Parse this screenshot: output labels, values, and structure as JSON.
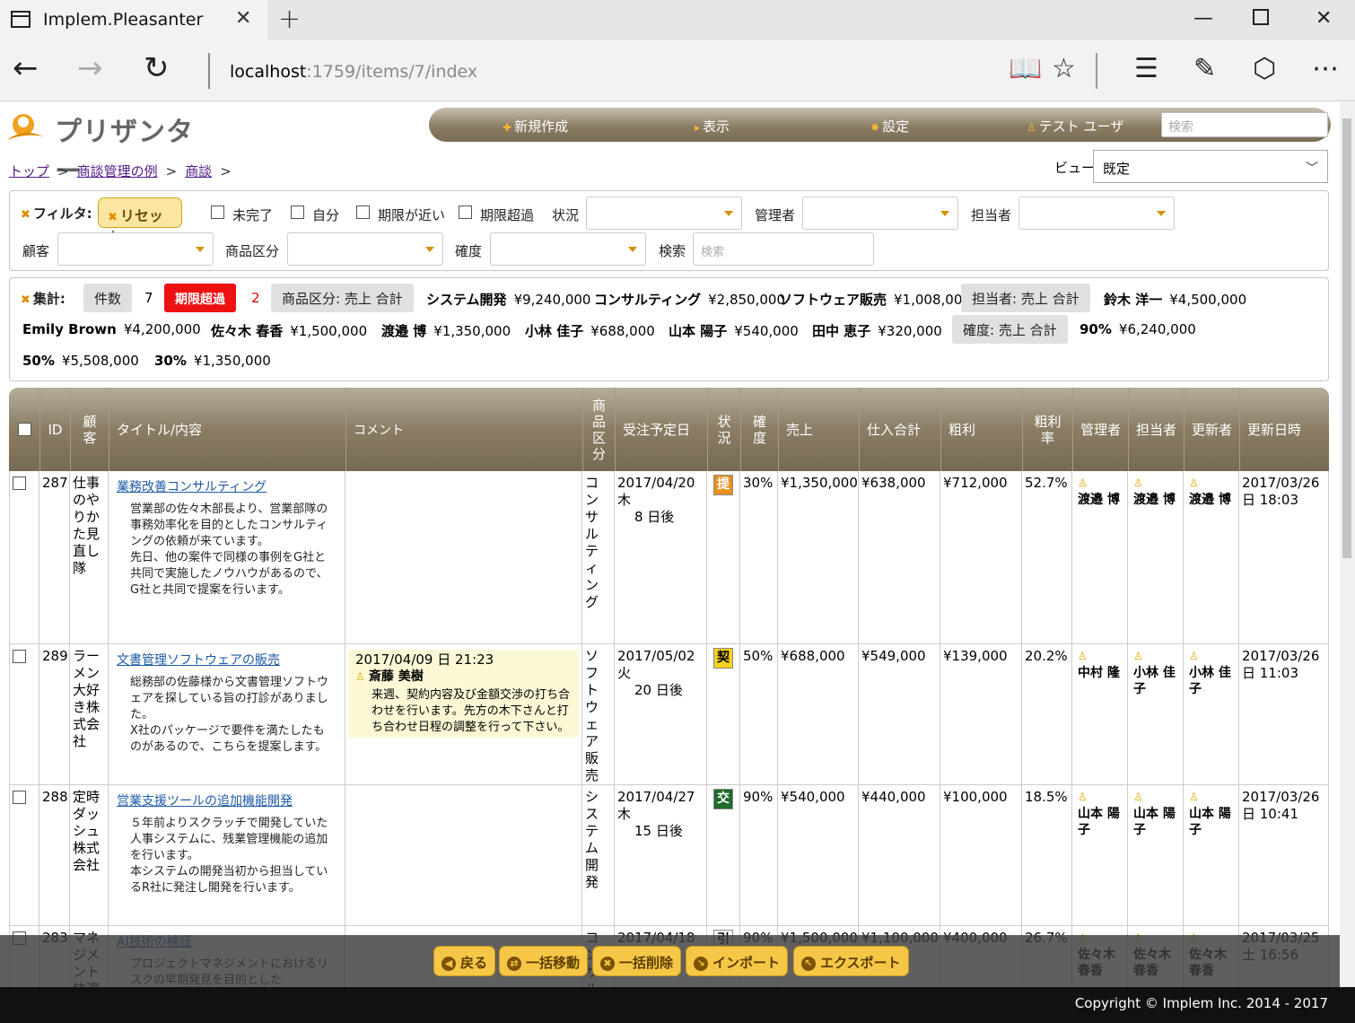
{
  "browser": {
    "tab_title": "Implem.Pleasanter",
    "url_host": "localhost",
    "url_path": ":1759/items/7/index"
  },
  "app": {
    "logo_text": "プリザンター",
    "nav": {
      "new": "新規作成",
      "view": "表示",
      "settings": "設定",
      "user": "テスト ユーザ",
      "search_placeholder": "検索"
    }
  },
  "breadcrumb": [
    "トップ",
    "商談管理の例",
    "商談"
  ],
  "view": {
    "label": "ビュー",
    "selected": "既定"
  },
  "filter": {
    "label": "フィルタ:",
    "reset": "リセット",
    "checks": [
      "未完了",
      "自分",
      "期限が近い",
      "期限超過"
    ],
    "status": "状況",
    "manager": "管理者",
    "owner": "担当者",
    "customer": "顧客",
    "product_type": "商品区分",
    "probability": "確度",
    "search": "検索",
    "search_placeholder": "検索"
  },
  "summary": {
    "label": "集計:",
    "count_label": "件数",
    "count_value": "7",
    "overdue_label": "期限超過",
    "overdue_value": "2",
    "group1": "商品区分: 売上 合計",
    "g1_items": [
      {
        "name": "システム開発",
        "value": "¥9,240,000"
      },
      {
        "name": "コンサルティング",
        "value": "¥2,850,000"
      },
      {
        "name": "ソフトウェア販売",
        "value": "¥1,008,000"
      }
    ],
    "group2": "担当者: 売上 合計",
    "g2_items": [
      {
        "name": "鈴木 洋一",
        "value": "¥4,500,000"
      },
      {
        "name": "Emily Brown",
        "value": "¥4,200,000"
      },
      {
        "name": "佐々木 春香",
        "value": "¥1,500,000"
      },
      {
        "name": "渡邉 博",
        "value": "¥1,350,000"
      },
      {
        "name": "小林 佳子",
        "value": "¥688,000"
      },
      {
        "name": "山本 陽子",
        "value": "¥540,000"
      },
      {
        "name": "田中 恵子",
        "value": "¥320,000"
      }
    ],
    "group3": "確度: 売上 合計",
    "g3_items": [
      {
        "name": "90%",
        "value": "¥6,240,000"
      },
      {
        "name": "50%",
        "value": "¥5,508,000"
      },
      {
        "name": "30%",
        "value": "¥1,350,000"
      }
    ]
  },
  "grid": {
    "headers": {
      "id": "ID",
      "customer": "顧客",
      "title": "タイトル/内容",
      "comment": "コメント",
      "product": "商品区分",
      "due": "受注予定日",
      "status": "状況",
      "prob": "確度",
      "sales": "売上",
      "cost": "仕入合計",
      "profit": "粗利",
      "margin": "粗利率",
      "manager": "管理者",
      "owner": "担当者",
      "updater": "更新者",
      "updated": "更新日時"
    },
    "rows": [
      {
        "id": "287",
        "customer": "仕事のやりかた見直し隊",
        "title": "業務改善コンサルティング",
        "body": "営業部の佐々木部長より、営業部隊の事務効率化を目的としたコンサルティングの依頼が来ています。\n先日、他の案件で同様の事例をG社と共同で実施したノウハウがあるので、G社と共同で提案を行います。",
        "comment_date": "",
        "comment_user": "",
        "comment_text": "",
        "product": "コンサルティング",
        "due": "2017/04/20 木",
        "due_rel": "8 日後",
        "status": "提",
        "status_color": "#e8901f",
        "status_fg": "#ffffff",
        "prob": "30%",
        "sales": "¥1,350,000",
        "cost": "¥638,000",
        "profit": "¥712,000",
        "margin": "52.7%",
        "manager": "渡邉 博",
        "owner": "渡邉 博",
        "updater": "渡邉 博",
        "updated": "2017/03/26 日 18:03"
      },
      {
        "id": "289",
        "customer": "ラーメン大好き株式会社",
        "title": "文書管理ソフトウェアの販売",
        "body": "総務部の佐藤様から文書管理ソフトウェアを探している旨の打診がありました。\nX社のパッケージで要件を満たしたものがあるので、こちらを提案します。",
        "comment_date": "2017/04/09 日 21:23",
        "comment_user": "斎藤 美樹",
        "comment_text": "来週、契約内容及び金額交渉の打ち合わせを行います。先方の木下さんと打ち合わせ日程の調整を行って下さい。",
        "product": "ソフトウェア販売",
        "due": "2017/05/02 火",
        "due_rel": "20 日後",
        "status": "契",
        "status_color": "#f5d21c",
        "status_fg": "#000000",
        "prob": "50%",
        "sales": "¥688,000",
        "cost": "¥549,000",
        "profit": "¥139,000",
        "margin": "20.2%",
        "manager": "中村 隆",
        "owner": "小林 佳子",
        "updater": "小林 佳子",
        "updated": "2017/03/26 日 11:03"
      },
      {
        "id": "288",
        "customer": "定時ダッシュ株式会社",
        "title": "営業支援ツールの追加機能開発",
        "body": "５年前よりスクラッチで開発していた人事システムに、残業管理機能の追加を行います。\n本システムの開発当初から担当しているR社に発注し開発を行います。",
        "comment_date": "",
        "comment_user": "",
        "comment_text": "",
        "product": "システム開発",
        "due": "2017/04/27 木",
        "due_rel": "15 日後",
        "status": "交",
        "status_color": "#1f6b2b",
        "status_fg": "#ffffff",
        "prob": "90%",
        "sales": "¥540,000",
        "cost": "¥440,000",
        "profit": "¥100,000",
        "margin": "18.5%",
        "manager": "山本 陽子",
        "owner": "山本 陽子",
        "updater": "山本 陽子",
        "updated": "2017/03/26 日 10:41"
      },
      {
        "id": "283",
        "customer": "マネジメント快適化",
        "title": "AI技術の検証",
        "body": "プロジェクトマネジメントにおけるリスクの早期発見を目的とした",
        "comment_date": "",
        "comment_user": "",
        "comment_text": "",
        "product": "コンサルティング",
        "due": "2017/04/18",
        "due_rel": "",
        "status": "引",
        "status_color": "#ffffff",
        "status_fg": "#000000",
        "prob": "90%",
        "sales": "¥1,500,000",
        "cost": "¥1,100,000",
        "profit": "¥400,000",
        "margin": "26.7%",
        "manager": "佐々木 春香",
        "owner": "佐々木 春香",
        "updater": "佐々木 春香",
        "updated": "2017/03/25 土 16:56"
      }
    ]
  },
  "bottom_buttons": [
    "戻る",
    "一括移動",
    "一括削除",
    "インポート",
    "エクスポート"
  ],
  "footer": "Copyright © Implem Inc. 2014 - 2017"
}
